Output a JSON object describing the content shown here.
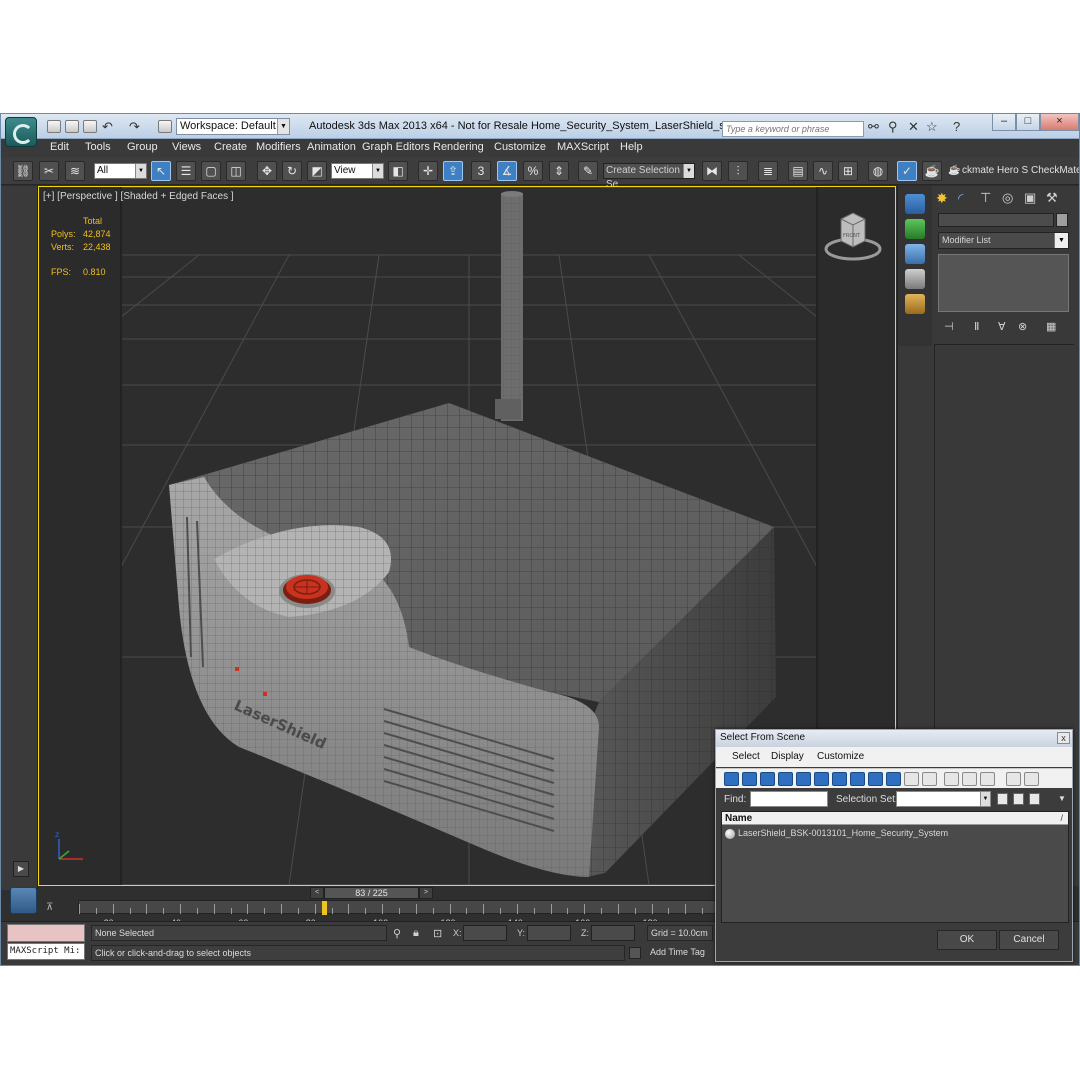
{
  "window": {
    "workspace": "Workspace: Default",
    "title": "Autodesk 3ds Max  2013 x64    - Not for Resale      Home_Security_System_LaserShield_sig.max",
    "search_placeholder": "Type a keyword or phrase",
    "help_label": "?",
    "minimize": "–",
    "maximize": "□",
    "close": "×"
  },
  "menu": [
    "Edit",
    "Tools",
    "Group",
    "Views",
    "Create",
    "Modifiers",
    "Animation",
    "Graph Editors",
    "Rendering",
    "Customize",
    "MAXScript",
    "Help"
  ],
  "toolbar": {
    "selection_filter": "All",
    "reference_coord": "View",
    "snap_number": "3",
    "angle_snap": "%",
    "named_selection_placeholder": "Create Selection Se",
    "extra_labels": [
      "ckmate Hero S",
      "CheckMate"
    ]
  },
  "viewport": {
    "label": "[+] [Perspective ] [Shaded + Edged Faces ]",
    "stats": {
      "header": "Total",
      "polys_label": "Polys:",
      "polys": "42,874",
      "verts_label": "Verts:",
      "verts": "22,438",
      "fps_label": "FPS:",
      "fps": "0.810"
    },
    "viewcube_label": "FRONT",
    "product_label": "LaserShield"
  },
  "command_panel": {
    "modifier_list": "Modifier List"
  },
  "timeline": {
    "frame_display": "83 / 225",
    "current_frame": 83,
    "total_frames": 225,
    "prev": "<",
    "next": ">",
    "ticks": [
      "20",
      "40",
      "60",
      "80",
      "100",
      "120",
      "140",
      "160",
      "180"
    ]
  },
  "status": {
    "maxscript_listener": "MAXScript Mi:",
    "selection": "None Selected",
    "prompt": "Click or click-and-drag to select objects",
    "x_label": "X:",
    "y_label": "Y:",
    "z_label": "Z:",
    "grid": "Grid = 10.0cm",
    "add_time_tag": "Add Time Tag"
  },
  "select_dialog": {
    "title": "Select From Scene",
    "close": "x",
    "menu": [
      "Select",
      "Display",
      "Customize"
    ],
    "find_label": "Find:",
    "selection_set_label": "Selection Set:",
    "column_name": "Name",
    "sort_glyph": "/",
    "items": [
      "LaserShield_BSK-0013101_Home_Security_System"
    ],
    "ok": "OK",
    "cancel": "Cancel"
  },
  "colors": {
    "viewport_border": "#f3d60e",
    "stats_text": "#f0c020",
    "accent_blue": "#3f7fc4",
    "alarm_red": "#c8321e"
  }
}
